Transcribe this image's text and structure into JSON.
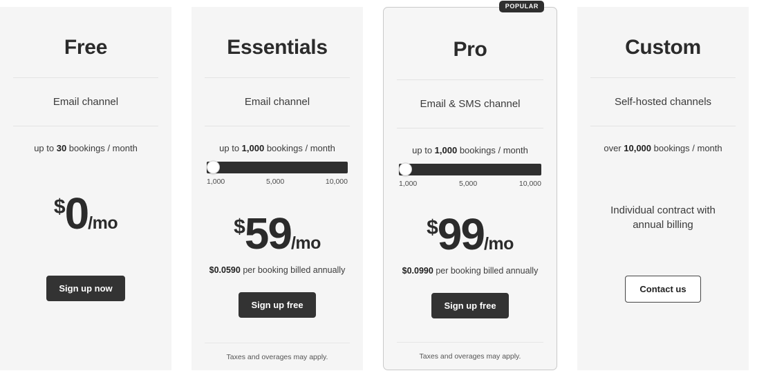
{
  "page": {
    "background": "#ffffff",
    "card_background": "#f5f5f5",
    "accent_dark": "#333333",
    "divider_color": "#e3e3e3"
  },
  "plans": [
    {
      "id": "free",
      "name": "Free",
      "channel": "Email channel",
      "bookings_prefix": "up to ",
      "bookings_value": "30",
      "bookings_suffix": " bookings / month",
      "has_slider": false,
      "price_currency": "$",
      "price_amount": "0",
      "price_period": "/mo",
      "per_booking": null,
      "cta_label": "Sign up now",
      "cta_style": "solid",
      "footnote": null,
      "featured": false,
      "badge": null
    },
    {
      "id": "essentials",
      "name": "Essentials",
      "channel": "Email channel",
      "bookings_prefix": "up to ",
      "bookings_value": "1,000",
      "bookings_suffix": " bookings / month",
      "has_slider": true,
      "slider": {
        "value": 1000,
        "min": 1000,
        "max": 10000,
        "thumb_position_pct": 0,
        "ticks": [
          "1,000",
          "5,000",
          "10,000"
        ]
      },
      "price_currency": "$",
      "price_amount": "59",
      "price_period": "/mo",
      "per_booking": {
        "rate": "$0.0590",
        "text": " per booking billed annually"
      },
      "cta_label": "Sign up free",
      "cta_style": "solid",
      "footnote": "Taxes and overages may apply.",
      "featured": false,
      "badge": null
    },
    {
      "id": "pro",
      "name": "Pro",
      "channel": "Email & SMS channel",
      "bookings_prefix": "up to ",
      "bookings_value": "1,000",
      "bookings_suffix": " bookings / month",
      "has_slider": true,
      "slider": {
        "value": 1000,
        "min": 1000,
        "max": 10000,
        "thumb_position_pct": 0,
        "ticks": [
          "1,000",
          "5,000",
          "10,000"
        ]
      },
      "price_currency": "$",
      "price_amount": "99",
      "price_period": "/mo",
      "per_booking": {
        "rate": "$0.0990",
        "text": " per booking billed annually"
      },
      "cta_label": "Sign up free",
      "cta_style": "solid",
      "footnote": "Taxes and overages may apply.",
      "featured": true,
      "badge": "POPULAR"
    },
    {
      "id": "custom",
      "name": "Custom",
      "channel": "Self-hosted channels",
      "bookings_prefix": "over ",
      "bookings_value": "10,000",
      "bookings_suffix": " bookings / month",
      "has_slider": false,
      "price_currency": null,
      "price_amount": null,
      "price_period": null,
      "per_booking": null,
      "custom_note_line1": "Individual contract with",
      "custom_note_line2": "annual billing",
      "cta_label": "Contact us",
      "cta_style": "outline",
      "footnote": null,
      "featured": false,
      "badge": null
    }
  ]
}
